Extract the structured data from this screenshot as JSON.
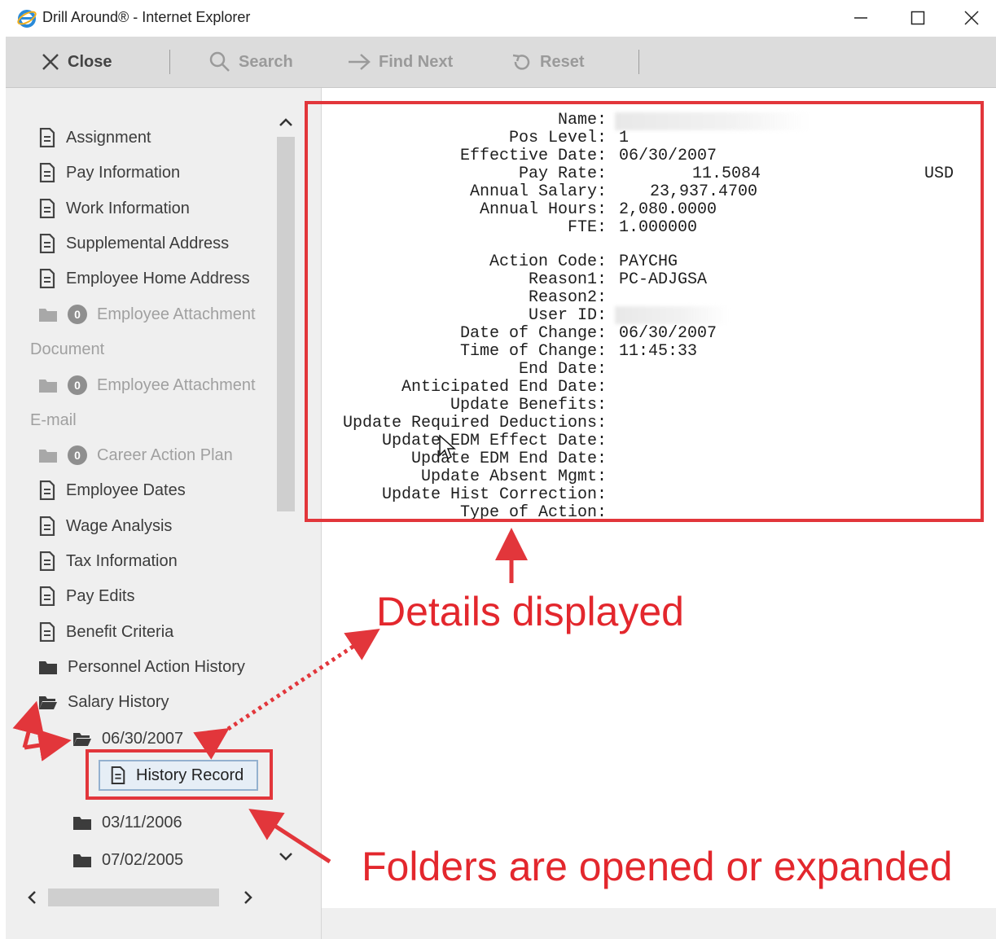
{
  "window": {
    "title": "Drill Around® - Internet Explorer",
    "controls": {
      "minimize": "–",
      "maximize": "☐",
      "close": "✕"
    }
  },
  "toolbar": {
    "close_label": "Close",
    "search_label": "Search",
    "find_next_label": "Find Next",
    "reset_label": "Reset"
  },
  "sidebar": {
    "items": [
      {
        "label": "Assignment",
        "icon": "document-icon"
      },
      {
        "label": "Pay Information",
        "icon": "document-icon"
      },
      {
        "label": "Work Information",
        "icon": "document-icon"
      },
      {
        "label": "Supplemental Address",
        "icon": "document-icon"
      },
      {
        "label": "Employee Home Address",
        "icon": "document-icon"
      },
      {
        "label": "Employee Attachment",
        "icon": "folder-icon",
        "count": "0"
      },
      {
        "label": "Employee Attachment",
        "icon": "folder-icon",
        "count": "0"
      },
      {
        "label": "Career Action Plan",
        "icon": "folder-icon",
        "count": "0"
      },
      {
        "label": "Employee Dates",
        "icon": "document-icon"
      },
      {
        "label": "Wage Analysis",
        "icon": "document-icon"
      },
      {
        "label": "Tax Information",
        "icon": "document-icon"
      },
      {
        "label": "Pay Edits",
        "icon": "document-icon"
      },
      {
        "label": "Benefit Criteria",
        "icon": "document-icon"
      },
      {
        "label": "Personnel Action History",
        "icon": "folder-icon"
      },
      {
        "label": "Salary History",
        "icon": "folder-open-icon"
      },
      {
        "label": "06/30/2007",
        "icon": "folder-open-icon"
      },
      {
        "label": "History Record",
        "icon": "document-icon"
      },
      {
        "label": "03/11/2006",
        "icon": "folder-icon"
      },
      {
        "label": "07/02/2005",
        "icon": "folder-icon"
      }
    ],
    "sections": {
      "document": "Document",
      "email": "E-mail"
    }
  },
  "details": {
    "rows": [
      {
        "label": "Name:",
        "value": ""
      },
      {
        "label": "Pos Level:",
        "value": "1"
      },
      {
        "label": "Effective Date:",
        "value": "06/30/2007"
      },
      {
        "label": "Pay Rate:",
        "value": "11.5084",
        "currency": "USD"
      },
      {
        "label": "Annual Salary:",
        "value": "23,937.4700"
      },
      {
        "label": "Annual Hours:",
        "value": "2,080.0000"
      },
      {
        "label": "FTE:",
        "value": "1.000000"
      },
      {
        "label": "Action Code:",
        "value": "PAYCHG"
      },
      {
        "label": "Reason1:",
        "value": "PC-ADJGSA"
      },
      {
        "label": "Reason2:",
        "value": ""
      },
      {
        "label": "User ID:",
        "value": ""
      },
      {
        "label": "Date of Change:",
        "value": "06/30/2007"
      },
      {
        "label": "Time of Change:",
        "value": "11:45:33"
      },
      {
        "label": "End Date:",
        "value": ""
      },
      {
        "label": "Anticipated End Date:",
        "value": ""
      },
      {
        "label": "Update Benefits:",
        "value": ""
      },
      {
        "label": "Update Required Deductions:",
        "value": ""
      },
      {
        "label": "Update EDM Effect Date:",
        "value": ""
      },
      {
        "label": "Update EDM End Date:",
        "value": ""
      },
      {
        "label": "Update Absent Mgmt:",
        "value": ""
      },
      {
        "label": "Update Hist Correction:",
        "value": ""
      },
      {
        "label": "Type of Action:",
        "value": ""
      }
    ]
  },
  "annotations": {
    "details_displayed": "Details displayed",
    "folders_opened": "Folders are opened or expanded",
    "color": "#e2363b"
  }
}
